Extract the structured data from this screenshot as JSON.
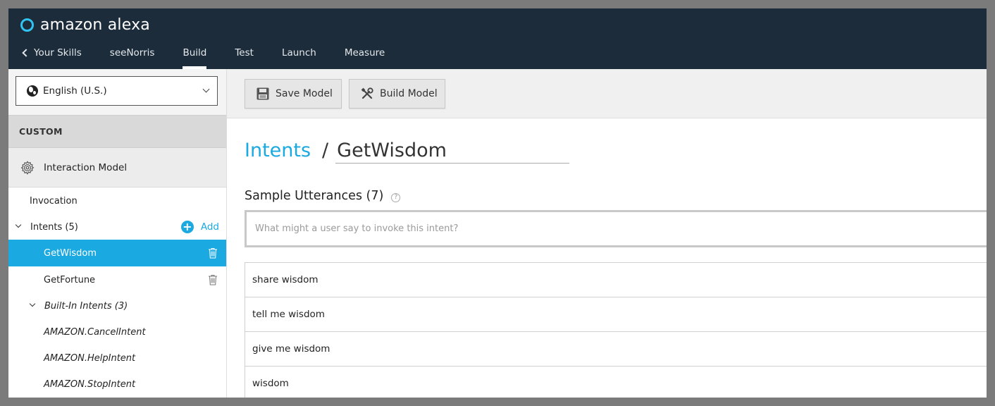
{
  "brand": {
    "name": "amazon alexa"
  },
  "nav": {
    "back_label": "Your Skills",
    "items": [
      "seeNorris",
      "Build",
      "Test",
      "Launch",
      "Measure"
    ],
    "active": "Build"
  },
  "sidebar": {
    "language": "English (U.S.)",
    "section": "CUSTOM",
    "interaction_model": "Interaction Model",
    "invocation": "Invocation",
    "intents_label": "Intents (5)",
    "add_label": "Add",
    "intents": [
      "GetWisdom",
      "GetFortune"
    ],
    "selected_intent": "GetWisdom",
    "builtin_label": "Built-In Intents (3)",
    "builtins": [
      "AMAZON.CancelIntent",
      "AMAZON.HelpIntent",
      "AMAZON.StopIntent"
    ]
  },
  "toolbar": {
    "save_label": "Save Model",
    "build_label": "Build Model"
  },
  "main": {
    "breadcrumb_link": "Intents",
    "separator": "/",
    "intent_name": "GetWisdom",
    "sample_title": "Sample Utterances (7)",
    "help_glyph": "?",
    "utterance_placeholder": "What might a user say to invoke this intent?",
    "utterances": [
      "share wisdom",
      "tell me wisdom",
      "give me wisdom",
      "wisdom"
    ]
  },
  "colors": {
    "header": "#1c2c3a",
    "accent": "#1ba9e1",
    "logo_ring": "#31c4f3"
  }
}
